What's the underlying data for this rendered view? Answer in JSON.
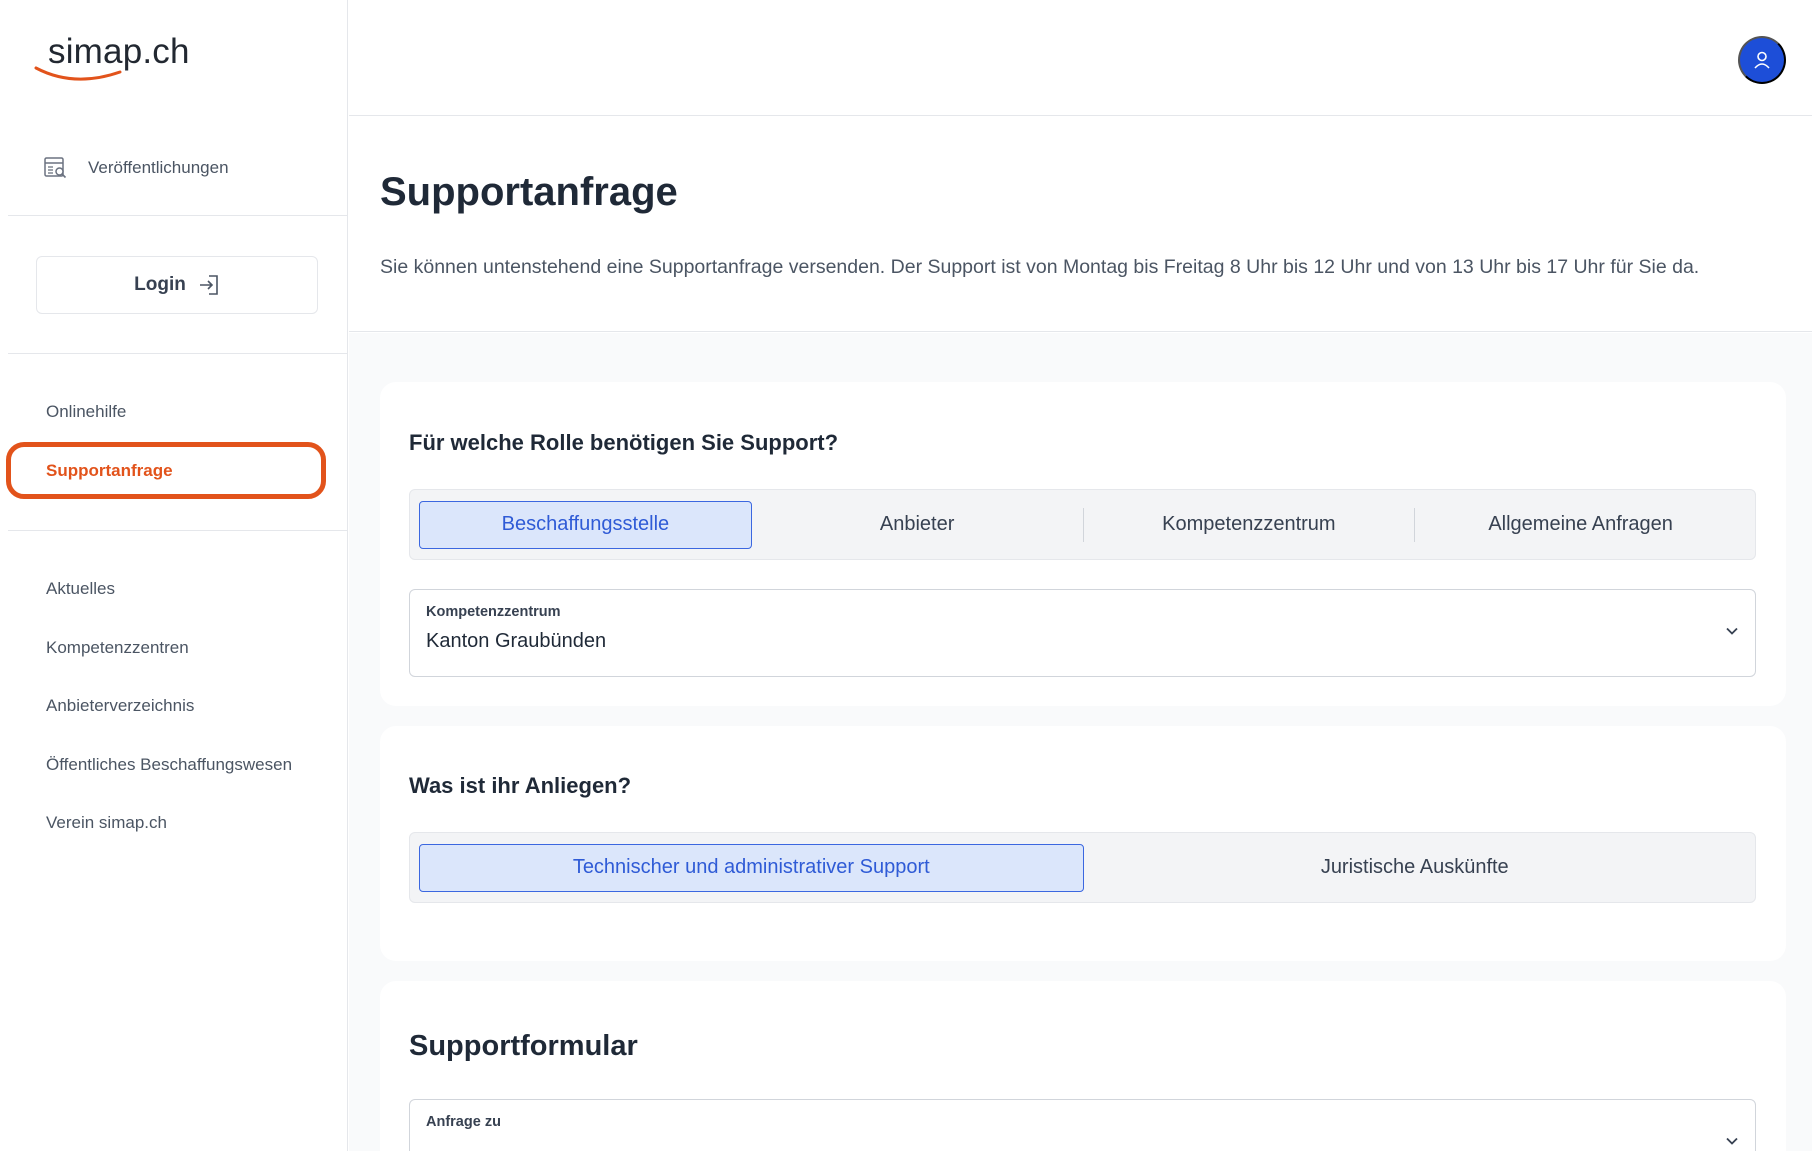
{
  "sidebar": {
    "logo_text": "simap.ch",
    "publications_label": "Veröffentlichungen",
    "login_label": "Login",
    "links": {
      "onlinehilfe": "Onlinehilfe",
      "supportanfrage": "Supportanfrage",
      "aktuelles": "Aktuelles",
      "kompetenzzentren": "Kompetenzzentren",
      "anbieterverzeichnis": "Anbieterverzeichnis",
      "beschaffungswesen": "Öffentliches Beschaffungswesen",
      "verein": "Verein simap.ch"
    }
  },
  "page": {
    "title": "Supportanfrage",
    "description": "Sie können untenstehend eine Supportanfrage versenden. Der Support ist von Montag bis Freitag 8 Uhr bis 12 Uhr und von 13 Uhr bis 17 Uhr für Sie da."
  },
  "role_card": {
    "title": "Für welche Rolle benötigen Sie Support?",
    "options": [
      "Beschaffungsstelle",
      "Anbieter",
      "Kompetenzzentrum",
      "Allgemeine Anfragen"
    ],
    "selected": "Beschaffungsstelle",
    "select": {
      "label": "Kompetenzzentrum",
      "value": "Kanton Graubünden"
    }
  },
  "concern_card": {
    "title": "Was ist ihr Anliegen?",
    "options": [
      "Technischer und administrativer Support",
      "Juristische Auskünfte"
    ],
    "selected": "Technischer und administrativer Support"
  },
  "form_card": {
    "title": "Supportformular",
    "select": {
      "label": "Anfrage zu",
      "value": ""
    }
  },
  "colors": {
    "accent": "#e2531b",
    "primary": "#2f5bd6",
    "avatar": "#1d4ed8"
  },
  "icons": [
    "publications-icon",
    "login-icon",
    "user-icon",
    "chevron-down-icon"
  ]
}
